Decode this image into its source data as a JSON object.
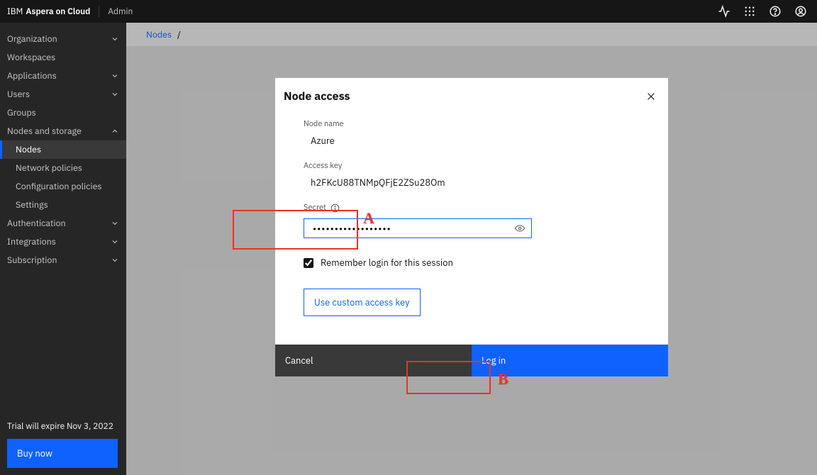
{
  "header": {
    "brand_prefix": "IBM",
    "brand_product": "Aspera on Cloud",
    "admin_label": "Admin"
  },
  "sidebar": {
    "items": [
      {
        "label": "Organization",
        "expandable": true
      },
      {
        "label": "Workspaces",
        "expandable": false
      },
      {
        "label": "Applications",
        "expandable": true
      },
      {
        "label": "Users",
        "expandable": true
      },
      {
        "label": "Groups",
        "expandable": false
      },
      {
        "label": "Nodes and storage",
        "expandable": true,
        "expanded": true,
        "children": [
          {
            "label": "Nodes",
            "active": true
          },
          {
            "label": "Network policies"
          },
          {
            "label": "Configuration policies"
          },
          {
            "label": "Settings"
          }
        ]
      },
      {
        "label": "Authentication",
        "expandable": true
      },
      {
        "label": "Integrations",
        "expandable": true
      },
      {
        "label": "Subscription",
        "expandable": true
      }
    ],
    "trial_text": "Trial will expire Nov 3, 2022",
    "buy_label": "Buy now"
  },
  "breadcrumb": {
    "root": "Nodes",
    "sep": "/"
  },
  "modal": {
    "title": "Node access",
    "node_name_label": "Node name",
    "node_name_value": "Azure",
    "access_key_label": "Access key",
    "access_key_value": "h2FKcU88TNMpQFjE2ZSu28Om",
    "secret_label": "Secret",
    "secret_value": "••••••••••••••••••",
    "remember_label": "Remember login for this session",
    "custom_key_label": "Use custom access key",
    "cancel_label": "Cancel",
    "login_label": "Log in"
  },
  "annotations": {
    "a": "A",
    "b": "B"
  }
}
